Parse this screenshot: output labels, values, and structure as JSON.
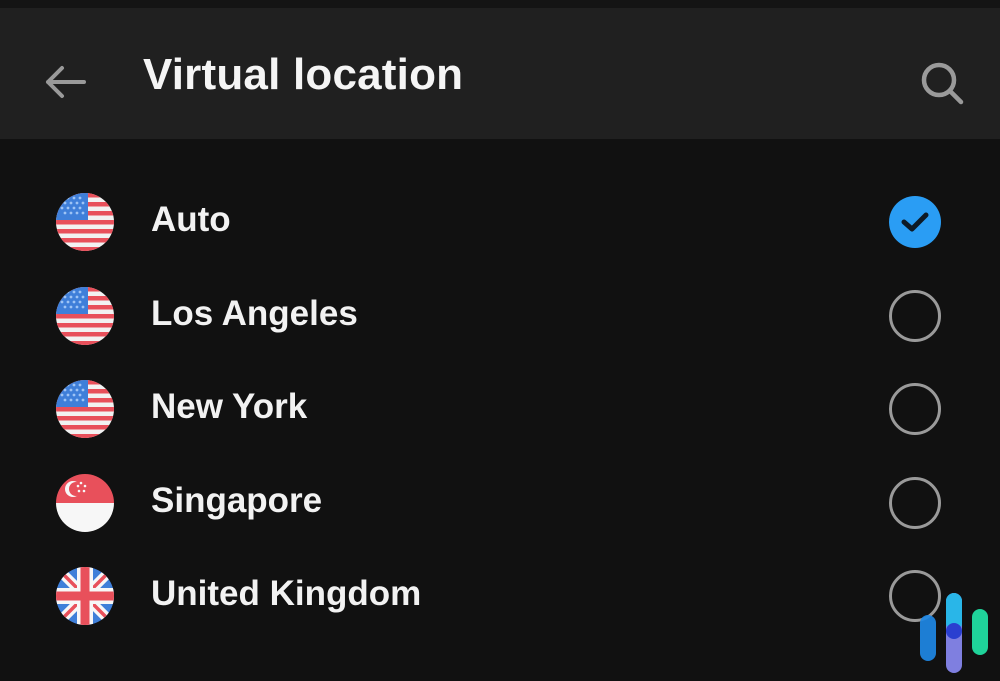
{
  "header": {
    "title": "Virtual location",
    "back_icon": "arrow-left-icon",
    "search_icon": "search-icon"
  },
  "locations": [
    {
      "label": "Auto",
      "flag": "us-flag-icon",
      "selected": true
    },
    {
      "label": "Los Angeles",
      "flag": "us-flag-icon",
      "selected": false
    },
    {
      "label": "New York",
      "flag": "us-flag-icon",
      "selected": false
    },
    {
      "label": "Singapore",
      "flag": "singapore-flag-icon",
      "selected": false
    },
    {
      "label": "United Kingdom",
      "flag": "uk-flag-icon",
      "selected": false
    }
  ],
  "colors": {
    "accent": "#2a9df4",
    "background": "#111111",
    "appbar": "#202020",
    "radio_border": "#9a9a9a"
  },
  "watermark": "brand-logo-icon"
}
